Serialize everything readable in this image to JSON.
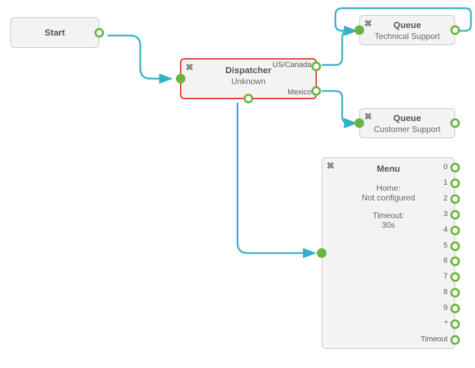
{
  "start": {
    "title": "Start"
  },
  "dispatcher": {
    "title": "Dispatcher",
    "sub": "Unknown",
    "out1": "US/Canada",
    "out2": "Mexico"
  },
  "queue1": {
    "title": "Queue",
    "sub": "Technical Support"
  },
  "queue2": {
    "title": "Queue",
    "sub": "Customer Support"
  },
  "menu": {
    "title": "Menu",
    "home_label": "Home:",
    "home_value": "Not configured",
    "timeout_label": "Timeout:",
    "timeout_value": "30s",
    "outs": [
      "0",
      "1",
      "2",
      "3",
      "4",
      "5",
      "6",
      "7",
      "8",
      "9",
      "*",
      "Timeout"
    ]
  },
  "colors": {
    "port": "#6db33f",
    "arrow": "#36b0c9",
    "selected": "#e03c31"
  }
}
